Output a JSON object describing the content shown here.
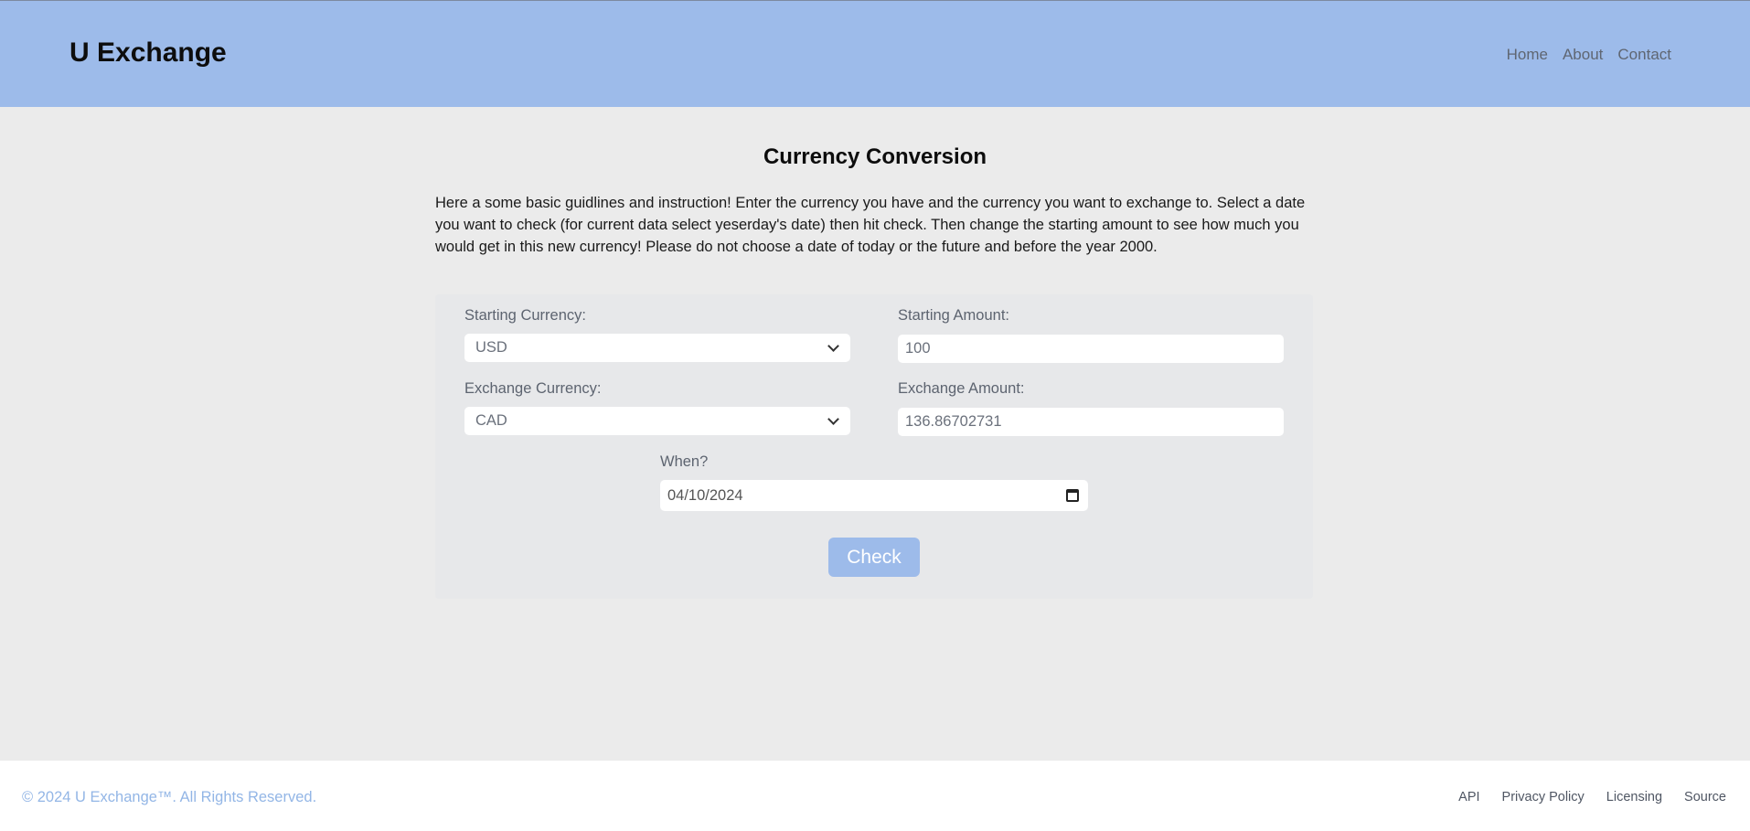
{
  "header": {
    "brand": "U Exchange",
    "nav": [
      "Home",
      "About",
      "Contact"
    ]
  },
  "main": {
    "title": "Currency Conversion",
    "intro": "Here a some basic guidlines and instruction! Enter the currency you have and the currency you want to exchange to. Select a date you want to check (for current data select yeserday's date) then hit check. Then change the starting amount to see how much you would get in this new currency! Please do not choose a date of today or the future and before the year 2000."
  },
  "form": {
    "starting_currency_label": "Starting Currency:",
    "starting_currency_value": "USD",
    "starting_amount_label": "Starting Amount:",
    "starting_amount_value": "100",
    "exchange_currency_label": "Exchange Currency:",
    "exchange_currency_value": "CAD",
    "exchange_amount_label": "Exchange Amount:",
    "exchange_amount_value": "136.86702731",
    "when_label": "When?",
    "when_value": "04/10/2024",
    "check_label": "Check"
  },
  "footer": {
    "copyright": "© 2024 U Exchange™. All Rights Reserved.",
    "links": [
      "API",
      "Privacy Policy",
      "Licensing",
      "Source"
    ]
  },
  "colors": {
    "header_bg": "#9dbbea",
    "page_bg": "#ebebeb",
    "accent": "#9dbbea"
  },
  "icons": {
    "select_arrow": "chevron-down-icon",
    "date_picker": "calendar-icon"
  }
}
